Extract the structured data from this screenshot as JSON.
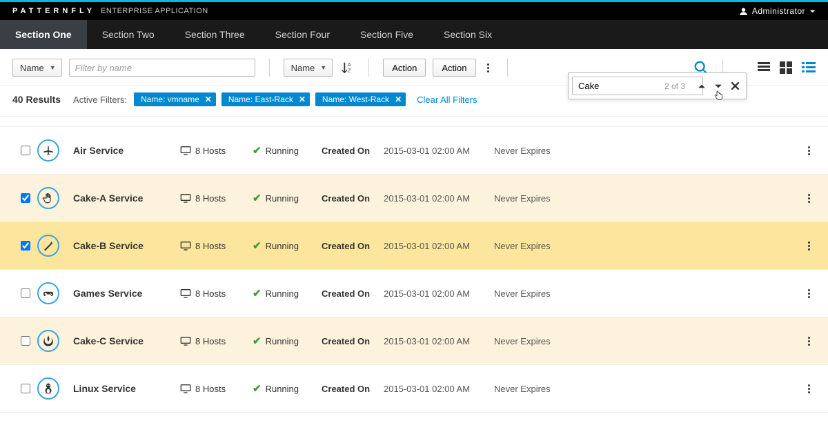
{
  "brand": {
    "name": "PATTERNFLY",
    "sub": "ENTERPRISE APPLICATION"
  },
  "user": {
    "name": "Administrator"
  },
  "nav": {
    "items": [
      {
        "label": "Section One",
        "active": true
      },
      {
        "label": "Section Two"
      },
      {
        "label": "Section Three"
      },
      {
        "label": "Section Four"
      },
      {
        "label": "Section Five"
      },
      {
        "label": "Section Six"
      }
    ]
  },
  "toolbar": {
    "filterField": "Name",
    "filterPlaceholder": "Filter by name",
    "sortField": "Name",
    "action1": "Action",
    "action2": "Action"
  },
  "results": {
    "count": "40 Results",
    "activeLabel": "Active Filters:"
  },
  "chips": [
    {
      "label": "Name: vmname"
    },
    {
      "label": "Name: East-Rack"
    },
    {
      "label": "Name: West-Rack"
    }
  ],
  "clearAll": "Clear All Filters",
  "find": {
    "value": "Cake",
    "count": "2 of 3"
  },
  "columns": {
    "hosts": "8 Hosts",
    "status": "Running",
    "createdLabel": "Created On",
    "createdValue": "2015-03-01 02:00 AM",
    "expires": "Never Expires"
  },
  "rows": [
    {
      "name": "Air Service",
      "icon": "plane",
      "checked": false,
      "highlight": ""
    },
    {
      "name": "Cake-A Service",
      "icon": "hand",
      "checked": true,
      "highlight": "light"
    },
    {
      "name": "Cake-B Service",
      "icon": "wand",
      "checked": true,
      "highlight": "strong"
    },
    {
      "name": "Games Service",
      "icon": "gamepad",
      "checked": false,
      "highlight": ""
    },
    {
      "name": "Cake-C Service",
      "icon": "rebel",
      "checked": false,
      "highlight": "light"
    },
    {
      "name": "Linux Service",
      "icon": "tux",
      "checked": false,
      "highlight": ""
    }
  ]
}
